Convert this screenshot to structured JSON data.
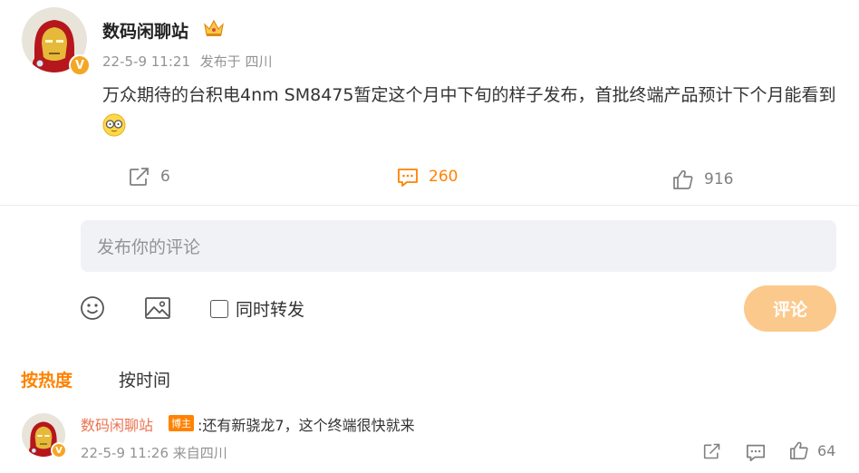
{
  "post": {
    "author": "数码闲聊站",
    "author_icon": "crown-icon",
    "timestamp": "22-5-9 11:21",
    "location": "发布于 四川",
    "text": "万众期待的台积电4nm SM8475暂定这个月中下旬的样子发布，首批终端产品预计下个月能看到",
    "verified_badge": "V",
    "actions": {
      "repost_count": "6",
      "comment_count": "260",
      "like_count": "916"
    }
  },
  "composer": {
    "placeholder": "发布你的评论",
    "also_repost_label": "同时转发",
    "submit_label": "评论"
  },
  "sort": {
    "hot_label": "按热度",
    "time_label": "按时间"
  },
  "comment": {
    "author": "数码闲聊站",
    "badge": "博主",
    "text": ":还有新骁龙7，这个终端很快就来",
    "timestamp": "22-5-9 11:26",
    "location": "来自四川",
    "like_count": "64",
    "verified_badge": "V"
  },
  "colors": {
    "accent": "#ff8200",
    "submit_disabled": "#fcc98c",
    "author_link": "#eb7350",
    "muted": "#939393"
  }
}
